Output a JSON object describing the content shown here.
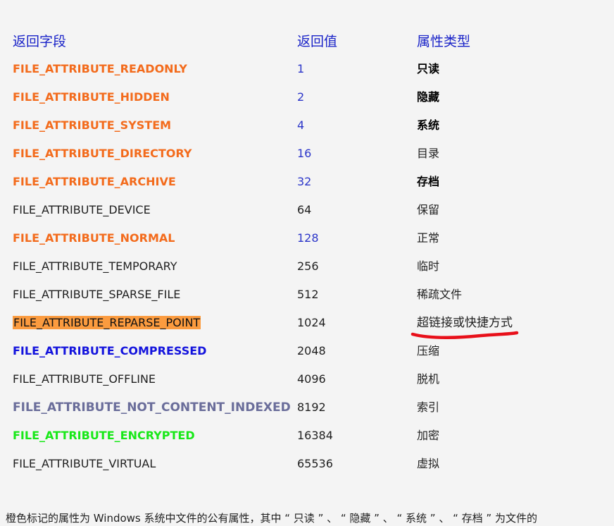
{
  "header": {
    "field": "返回字段",
    "value": "返回值",
    "type": "属性类型"
  },
  "rows": [
    {
      "field": "FILE_ATTRIBUTE_READONLY",
      "value": "1",
      "type": "只读"
    },
    {
      "field": "FILE_ATTRIBUTE_HIDDEN",
      "value": "2",
      "type": "隐藏"
    },
    {
      "field": "FILE_ATTRIBUTE_SYSTEM",
      "value": "4",
      "type": "系统"
    },
    {
      "field": "FILE_ATTRIBUTE_DIRECTORY",
      "value": "16",
      "type": "目录"
    },
    {
      "field": "FILE_ATTRIBUTE_ARCHIVE",
      "value": "32",
      "type": "存档"
    },
    {
      "field": "FILE_ATTRIBUTE_DEVICE",
      "value": "64",
      "type": "保留"
    },
    {
      "field": "FILE_ATTRIBUTE_NORMAL",
      "value": "128",
      "type": "正常"
    },
    {
      "field": "FILE_ATTRIBUTE_TEMPORARY",
      "value": "256",
      "type": "临时"
    },
    {
      "field": "FILE_ATTRIBUTE_SPARSE_FILE",
      "value": "512",
      "type": "稀疏文件"
    },
    {
      "field": "FILE_ATTRIBUTE_REPARSE_POINT",
      "value": "1024",
      "type": "超链接或快捷方式"
    },
    {
      "field": "FILE_ATTRIBUTE_COMPRESSED",
      "value": "2048",
      "type": "压缩"
    },
    {
      "field": "FILE_ATTRIBUTE_OFFLINE",
      "value": "4096",
      "type": "脱机"
    },
    {
      "field": "FILE_ATTRIBUTE_NOT_CONTENT_INDEXED",
      "value": "8192",
      "type": "索引"
    },
    {
      "field": "FILE_ATTRIBUTE_ENCRYPTED",
      "value": "16384",
      "type": "加密"
    },
    {
      "field": "FILE_ATTRIBUTE_VIRTUAL",
      "value": "65536",
      "type": "虚拟"
    }
  ],
  "footer": {
    "note": "橙色标记的属性为 Windows 系统中文件的公有属性，其中 “ 只读 ” 、 “ 隐藏 ” 、 “ 系统 ” 、 “ 存档 ” 为文件的"
  },
  "colors": {
    "header": "#1a23c8",
    "orange": "#f36b1c",
    "value_blue": "#2b35c9",
    "highlight": "#fb9b3f",
    "compressed_blue": "#1313dd",
    "not_indexed_slate": "#6a6d9a",
    "encrypted_green": "#18e818",
    "annotation_red": "#e8101a"
  }
}
